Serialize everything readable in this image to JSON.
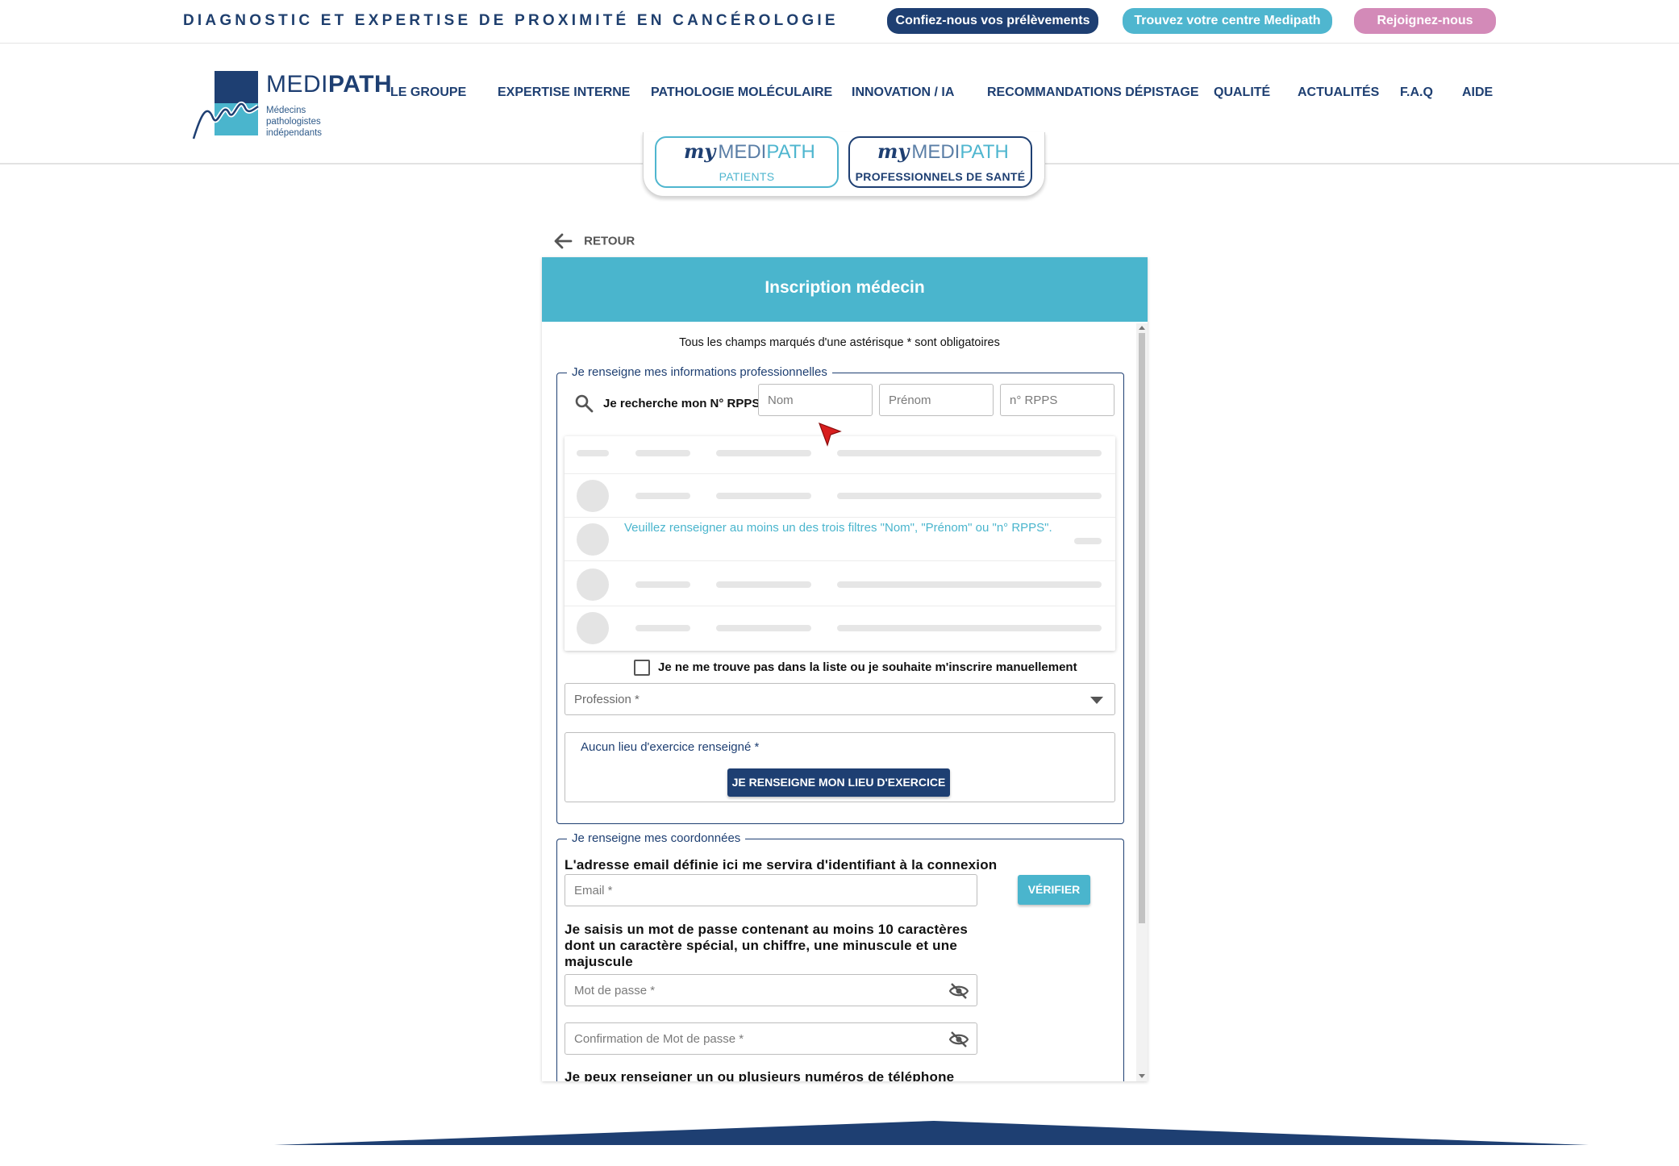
{
  "topbar": {
    "tagline": "DIAGNOSTIC ET EXPERTISE DE PROXIMITÉ EN CANCÉROLOGIE",
    "buttons": [
      "Confiez-nous vos prélèvements",
      "Trouvez votre centre Medipath",
      "Rejoignez-nous"
    ]
  },
  "logo": {
    "name_a": "MEDI",
    "name_b": "PATH",
    "subtitle": "Médecins pathologistes indépendants"
  },
  "nav": [
    "LE GROUPE",
    "EXPERTISE INTERNE",
    "PATHOLOGIE MOLÉCULAIRE",
    "INNOVATION / IA",
    "RECOMMANDATIONS DÉPISTAGE",
    "QUALITÉ",
    "ACTUALITÉS",
    "F.A.Q",
    "AIDE"
  ],
  "mymedipath": {
    "my": "my",
    "medi": "MEDI",
    "path": "PATH",
    "patients": "PATIENTS",
    "pros": "PROFESSIONNELS DE SANTÉ"
  },
  "back_label": "RETOUR",
  "form": {
    "title": "Inscription médecin",
    "notice": "Tous les champs marqués d'une astérisque * sont obligatoires",
    "section_pro": "Je renseigne mes informations professionnelles",
    "search_label": "Je recherche mon N° RPPS :",
    "placeholders": {
      "nom": "Nom",
      "prenom": "Prénom",
      "rpps": "n° RPPS"
    },
    "filter_message": "Veuillez renseigner au moins un des trois filtres \"Nom\", \"Prénom\" ou \"n° RPPS\".",
    "manual_checkbox": "Je ne me trouve pas dans la liste ou je souhaite m'inscrire manuellement",
    "manual_checked": false,
    "profession_placeholder": "Profession *",
    "lieu_label": "Aucun lieu d'exercice renseigné *",
    "lieu_button": "JE RENSEIGNE MON LIEU D'EXERCICE",
    "section_coord": "Je renseigne mes coordonnées",
    "email_heading": "L'adresse email définie ici me servira d'identifiant à la connexion",
    "email_placeholder": "Email *",
    "verify_button": "VÉRIFIER",
    "password_heading": "Je saisis un mot de passe contenant au moins 10 caractères dont un caractère spécial, un chiffre, une minuscule et une majuscule",
    "password_placeholder": "Mot de passe *",
    "password_confirm_placeholder": "Confirmation de Mot de passe *",
    "phone_heading": "Je peux renseigner un ou plusieurs numéros de téléphone"
  },
  "colors": {
    "navy": "#1e3f72",
    "teal": "#4ab5cd",
    "pink": "#d38ab8"
  },
  "icons": [
    "search-icon",
    "eye-off-icon",
    "arrow-left-icon",
    "chevron-down-icon",
    "cursor-icon"
  ]
}
